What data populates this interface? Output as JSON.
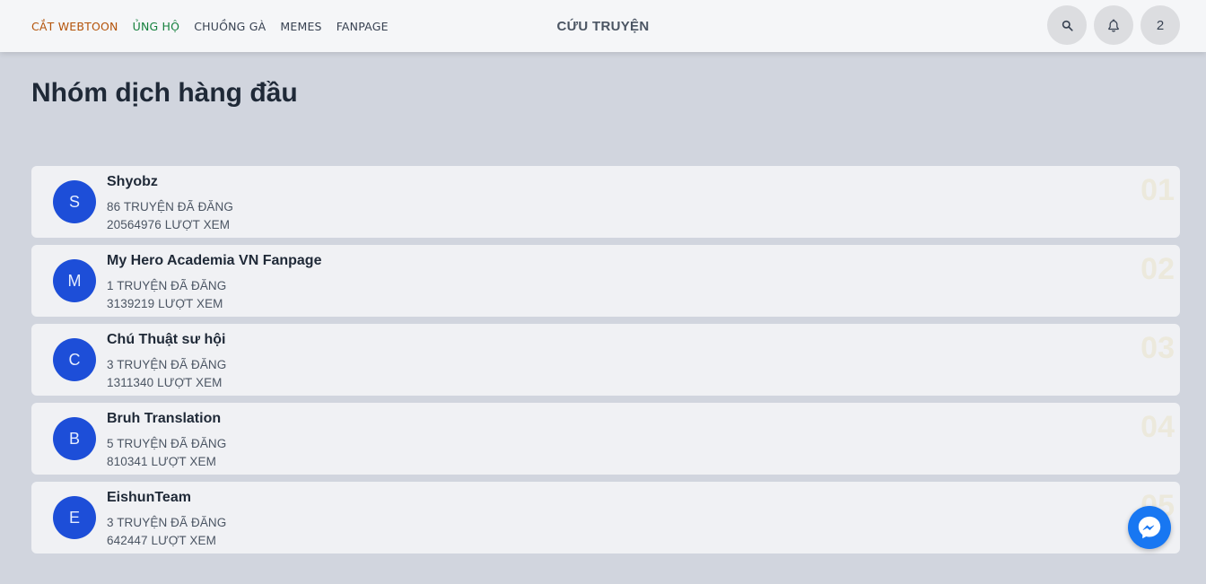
{
  "nav": {
    "links": [
      {
        "label": "CẮT WEBTOON",
        "color": "#b45309"
      },
      {
        "label": "ỦNG HỘ",
        "color": "#15803d"
      },
      {
        "label": "CHUỒNG GÀ"
      },
      {
        "label": "MEMES"
      },
      {
        "label": "FANPAGE"
      }
    ],
    "brand": "CỨU TRUYỆN",
    "actions": {
      "search_icon": "search-icon",
      "bell_icon": "bell-icon",
      "user_label": "2"
    }
  },
  "page": {
    "title": "Nhóm dịch hàng đầu"
  },
  "groups": [
    {
      "initial": "S",
      "name": "Shyobz",
      "stories": "86 TRUYỆN ĐÃ ĐĂNG",
      "views": "20564976 LƯỢT XEM",
      "rank": "01"
    },
    {
      "initial": "M",
      "name": "My Hero Academia VN Fanpage",
      "stories": "1 TRUYỆN ĐÃ ĐĂNG",
      "views": "3139219 LƯỢT XEM",
      "rank": "02"
    },
    {
      "initial": "C",
      "name": "Chú Thuật sư hội",
      "stories": "3 TRUYỆN ĐÃ ĐĂNG",
      "views": "1311340 LƯỢT XEM",
      "rank": "03"
    },
    {
      "initial": "B",
      "name": "Bruh Translation",
      "stories": "5 TRUYỆN ĐÃ ĐĂNG",
      "views": "810341 LƯỢT XEM",
      "rank": "04"
    },
    {
      "initial": "E",
      "name": "EishunTeam",
      "stories": "3 TRUYỆN ĐÃ ĐĂNG",
      "views": "642447 LƯỢT XEM",
      "rank": "05"
    }
  ],
  "colors": {
    "background": "#d1d5de",
    "card": "#f0f1f4",
    "avatar": "#1d4ed8",
    "messenger": "#1877f2"
  },
  "widget": {
    "icon": "messenger-icon"
  }
}
